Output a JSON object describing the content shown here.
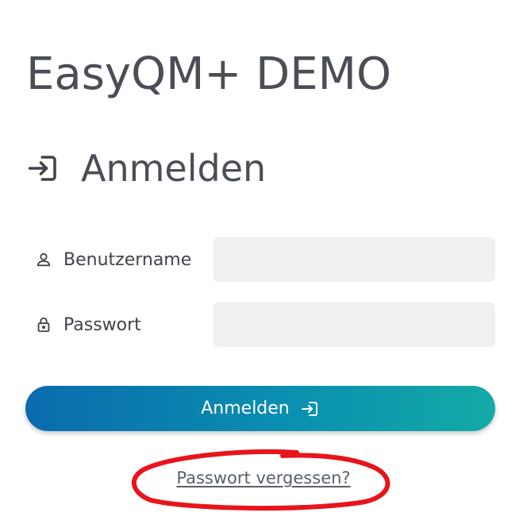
{
  "app": {
    "title": "EasyQM+ DEMO"
  },
  "login": {
    "heading": "Anmelden",
    "heading_icon": "login-arrow-icon",
    "username": {
      "label": "Benutzername",
      "icon": "user-icon",
      "value": "",
      "placeholder": ""
    },
    "password": {
      "label": "Passwort",
      "icon": "lock-icon",
      "value": "",
      "placeholder": ""
    },
    "submit": {
      "label": "Anmelden",
      "icon": "login-arrow-icon"
    },
    "forgot_password": "Passwort vergessen?"
  },
  "colors": {
    "text": "#4a4e55",
    "input_bg": "#eff0f0",
    "button_gradient_start": "#0a6bad",
    "button_gradient_end": "#13aaa6",
    "annotation": "#e8141c"
  }
}
